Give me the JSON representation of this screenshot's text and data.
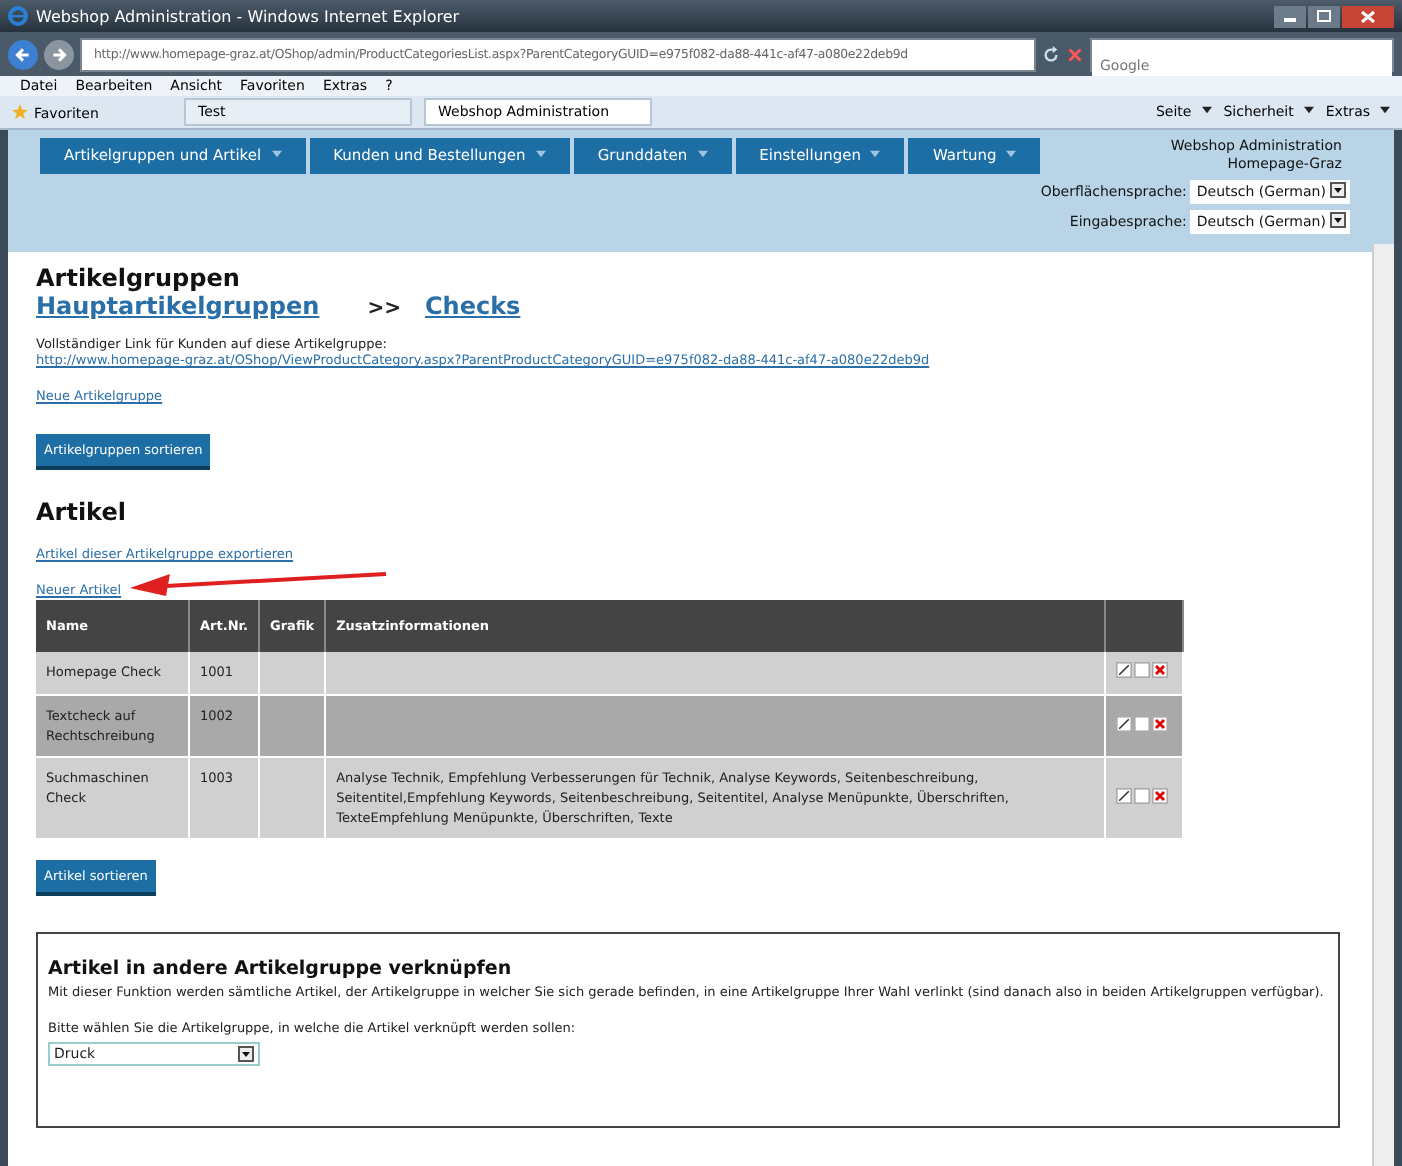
{
  "window": {
    "title": "Webshop Administration - Windows Internet Explorer"
  },
  "address_bar": {
    "url": "http://www.homepage-graz.at/OShop/admin/ProductCategoriesList.aspx?ParentCategoryGUID=e975f082-da88-441c-af47-a080e22deb9d"
  },
  "search": {
    "placeholder": "Google"
  },
  "menu": [
    "Datei",
    "Bearbeiten",
    "Ansicht",
    "Favoriten",
    "Extras",
    "?"
  ],
  "favorites_bar": {
    "favorites": "Favoriten",
    "tabs": [
      {
        "label": "Test",
        "selected": false
      },
      {
        "label": "Webshop Administration",
        "selected": true
      }
    ],
    "tools": [
      "Seite",
      "Sicherheit",
      "Extras"
    ]
  },
  "nav": {
    "items": [
      "Artikelgruppen und Artikel",
      "Kunden und Bestellungen",
      "Grunddaten",
      "Einstellungen",
      "Wartung"
    ],
    "site": [
      "Webshop Administration",
      "Homepage-Graz"
    ],
    "languages": [
      {
        "label": "Oberflächensprache:",
        "value": "Deutsch (German)"
      },
      {
        "label": "Eingabesprache:",
        "value": "Deutsch (German)"
      }
    ]
  },
  "groups": {
    "title": "Artikelgruppen",
    "breadcrumb": [
      "Hauptartikelgruppen",
      ">>",
      "Checks"
    ],
    "link_label": "Vollständiger Link für Kunden auf diese Artikelgruppe:",
    "link": "http://www.homepage-graz.at/OShop/ViewProductCategory.aspx?ParentProductCategoryGUID=e975f082-da88-441c-af47-a080e22deb9d",
    "new_link": "Neue Artikelgruppe",
    "sort_button": "Artikelgruppen sortieren"
  },
  "articles": {
    "title": "Artikel",
    "export_link": "Artikel dieser Artikelgruppe exportieren",
    "new_link": "Neuer Artikel",
    "table": {
      "columns": [
        "Name",
        "Art.Nr.",
        "Grafik",
        "Zusatzinformationen"
      ],
      "rows": [
        {
          "name": "Homepage Check",
          "number": "1001",
          "info": ""
        },
        {
          "name": "Textcheck auf Rechtschreibung",
          "number": "1002",
          "info": ""
        },
        {
          "name": "Suchmaschinen Check",
          "number": "1003",
          "info": "Analyse Technik, Empfehlung Verbesserungen für Technik, Analyse  Keywords, Seitenbeschreibung, Seitentitel,Empfehlung Keywords, Seitenbeschreibung, Seitentitel, Analyse Menüpunkte, Überschriften, TexteEmpfehlung Menüpunkte, Überschriften, Texte"
        }
      ]
    },
    "sort_button": "Artikel sortieren"
  },
  "link_panel": {
    "title": "Artikel in andere Artikelgruppe verknüpfen",
    "description": "Mit dieser Funktion werden sämtliche Artikel, der Artikelgruppe in welcher Sie sich gerade befinden, in eine Artikelgruppe Ihrer Wahl verlinkt (sind danach also in beiden Artikelgruppen verfügbar).",
    "prompt": "Bitte wählen Sie die Artikelgruppe, in welche die Artikel verknüpft werden sollen:",
    "value": "Druck"
  }
}
